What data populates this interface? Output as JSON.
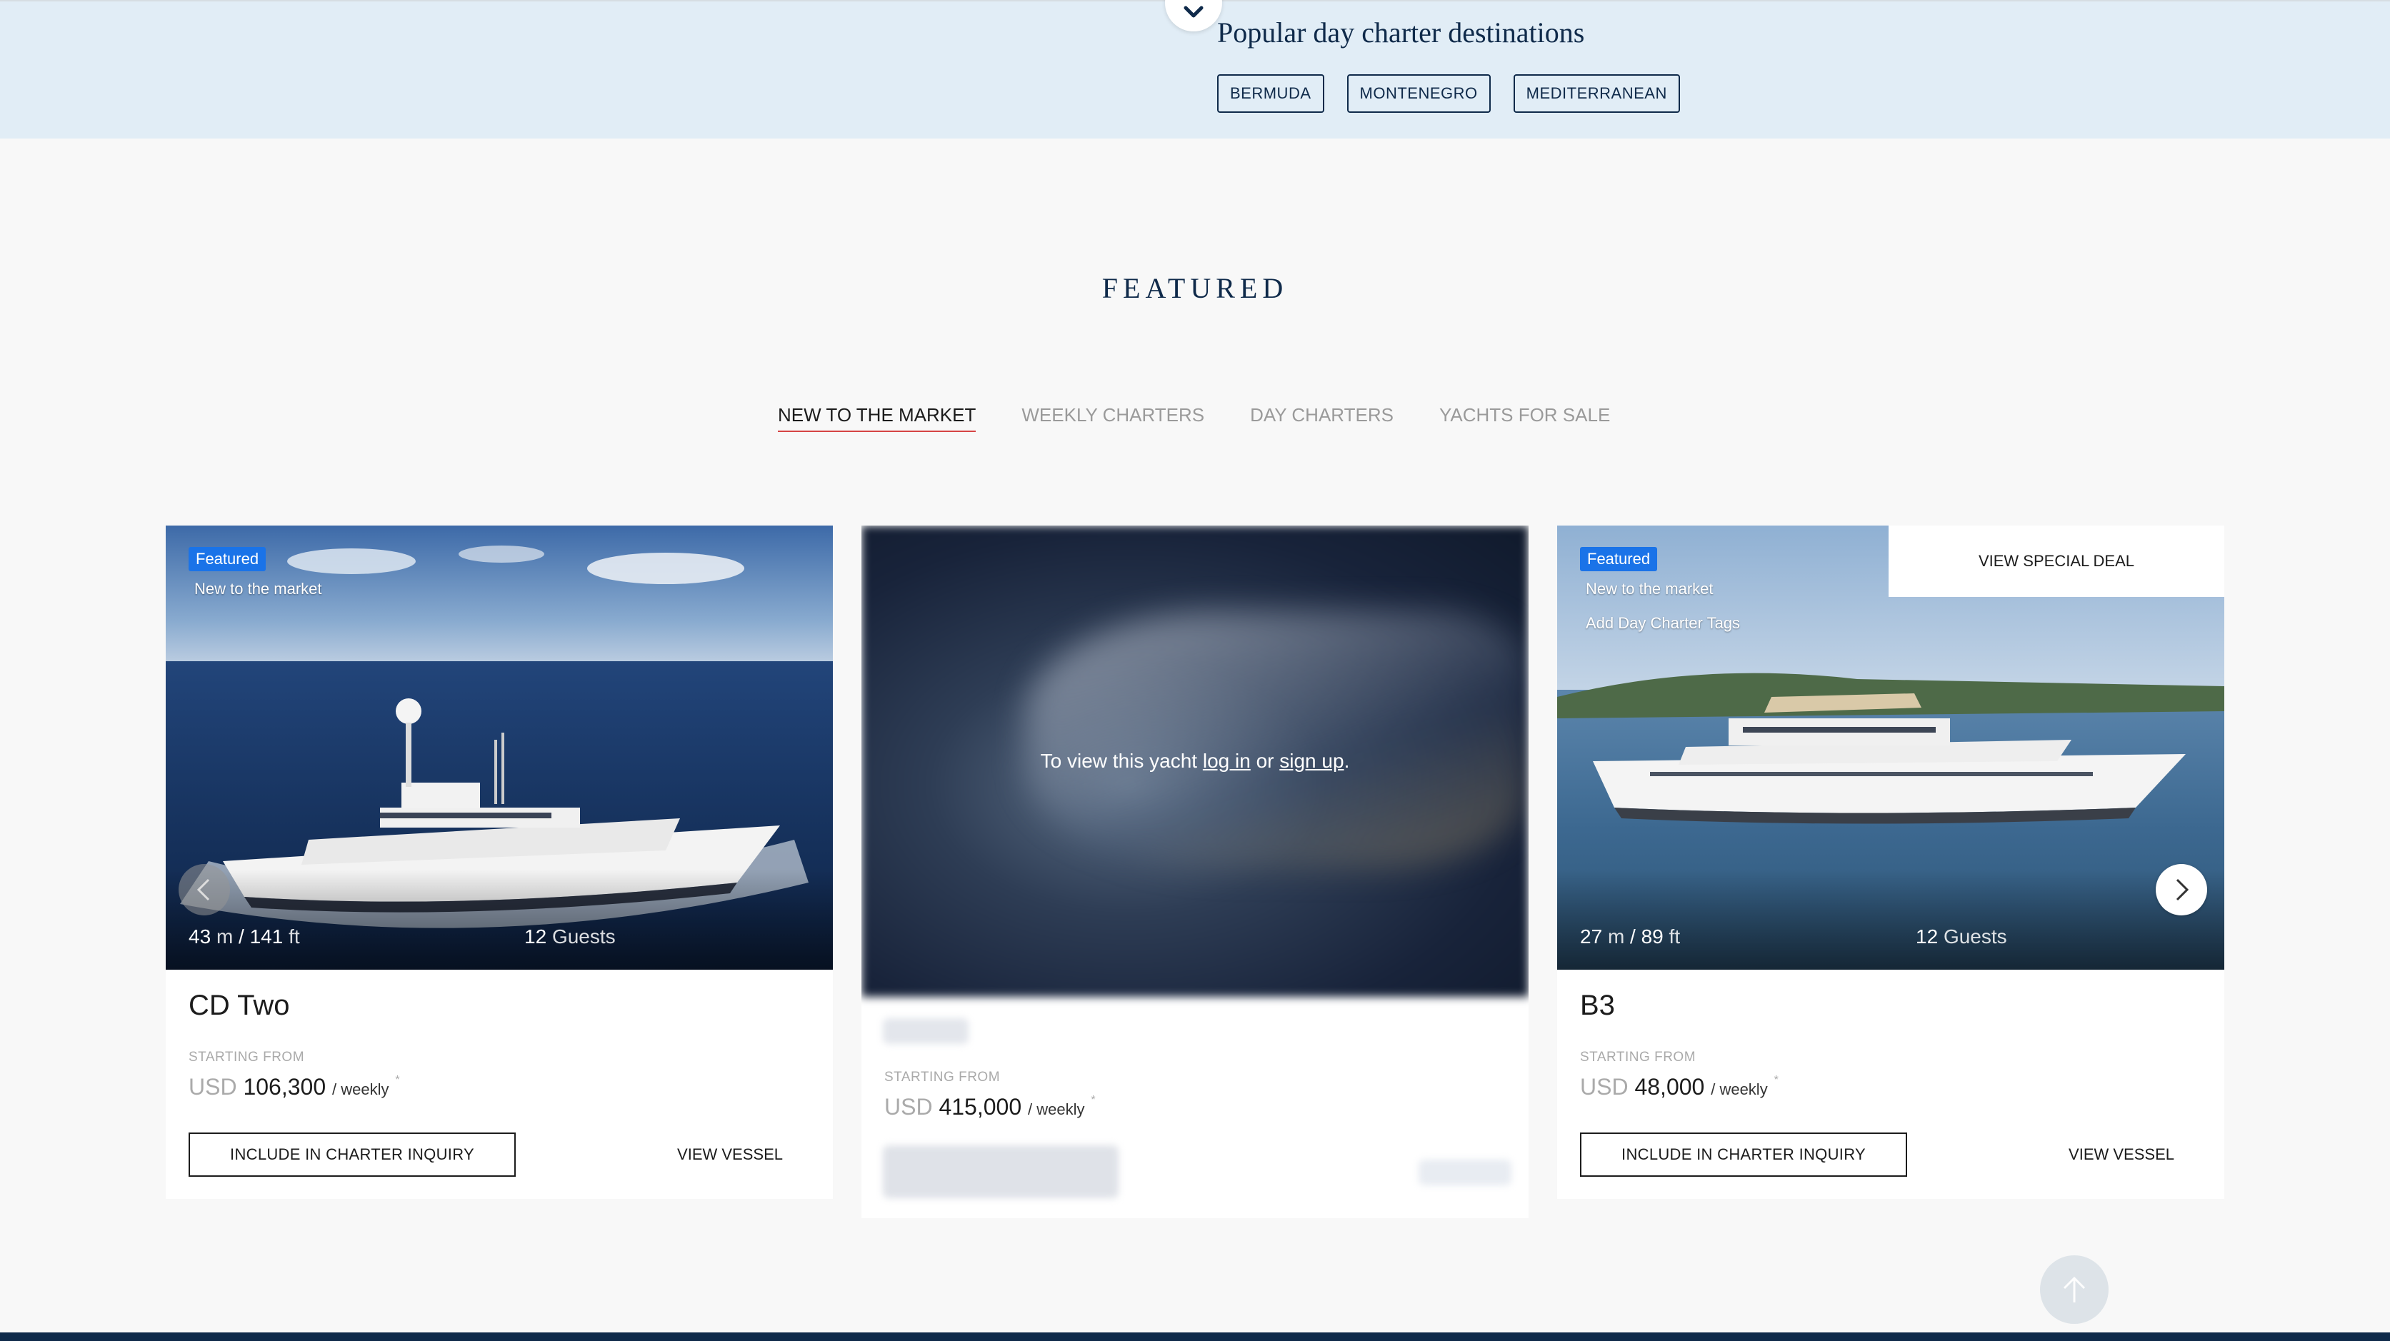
{
  "destinations": {
    "title": "Popular day charter destinations",
    "tags": [
      "BERMUDA",
      "MONTENEGRO",
      "MEDITERRANEAN"
    ]
  },
  "featured": {
    "heading": "FEATURED",
    "tabs": [
      "NEW TO THE MARKET",
      "WEEKLY CHARTERS",
      "DAY CHARTERS",
      "YACHTS FOR SALE"
    ],
    "active_tab": "NEW TO THE MARKET"
  },
  "cards": [
    {
      "badge": "Featured",
      "tags": [
        "New to the market"
      ],
      "length_m": "43",
      "length_m_unit": "m",
      "length_sep": "/",
      "length_ft": "141",
      "length_ft_unit": "ft",
      "guests_count": "12",
      "guests_label": "Guests",
      "name": "CD Two",
      "starting_from": "STARTING FROM",
      "currency": "USD",
      "price": "106,300",
      "period": "/ weekly",
      "asterisk": "*",
      "inquiry_label": "INCLUDE IN CHARTER INQUIRY",
      "view_label": "VIEW VESSEL"
    },
    {
      "lock_prefix": "To view this yacht",
      "login": "log in",
      "or": "or",
      "signup": "sign up",
      "period_end": ".",
      "starting_from": "STARTING FROM",
      "currency": "USD",
      "price": "415,000",
      "period": "/ weekly",
      "asterisk": "*"
    },
    {
      "badge": "Featured",
      "tags": [
        "New to the market",
        "Add Day Charter Tags"
      ],
      "special_deal": "VIEW SPECIAL DEAL",
      "length_m": "27",
      "length_m_unit": "m",
      "length_sep": "/",
      "length_ft": "89",
      "length_ft_unit": "ft",
      "guests_count": "12",
      "guests_label": "Guests",
      "name": "B3",
      "starting_from": "STARTING FROM",
      "currency": "USD",
      "price": "48,000",
      "period": "/ weekly",
      "asterisk": "*",
      "inquiry_label": "INCLUDE IN CHARTER INQUIRY",
      "view_label": "VIEW VESSEL"
    }
  ],
  "icons": {
    "expand": "chevron-down-icon",
    "prev": "chevron-left-icon",
    "next": "chevron-right-icon",
    "scroll_top": "arrow-up-icon"
  },
  "colors": {
    "navy": "#0f2a4a",
    "badge_blue": "#1a73e8",
    "active_underline": "#d64545",
    "band": "#e1edf6"
  }
}
